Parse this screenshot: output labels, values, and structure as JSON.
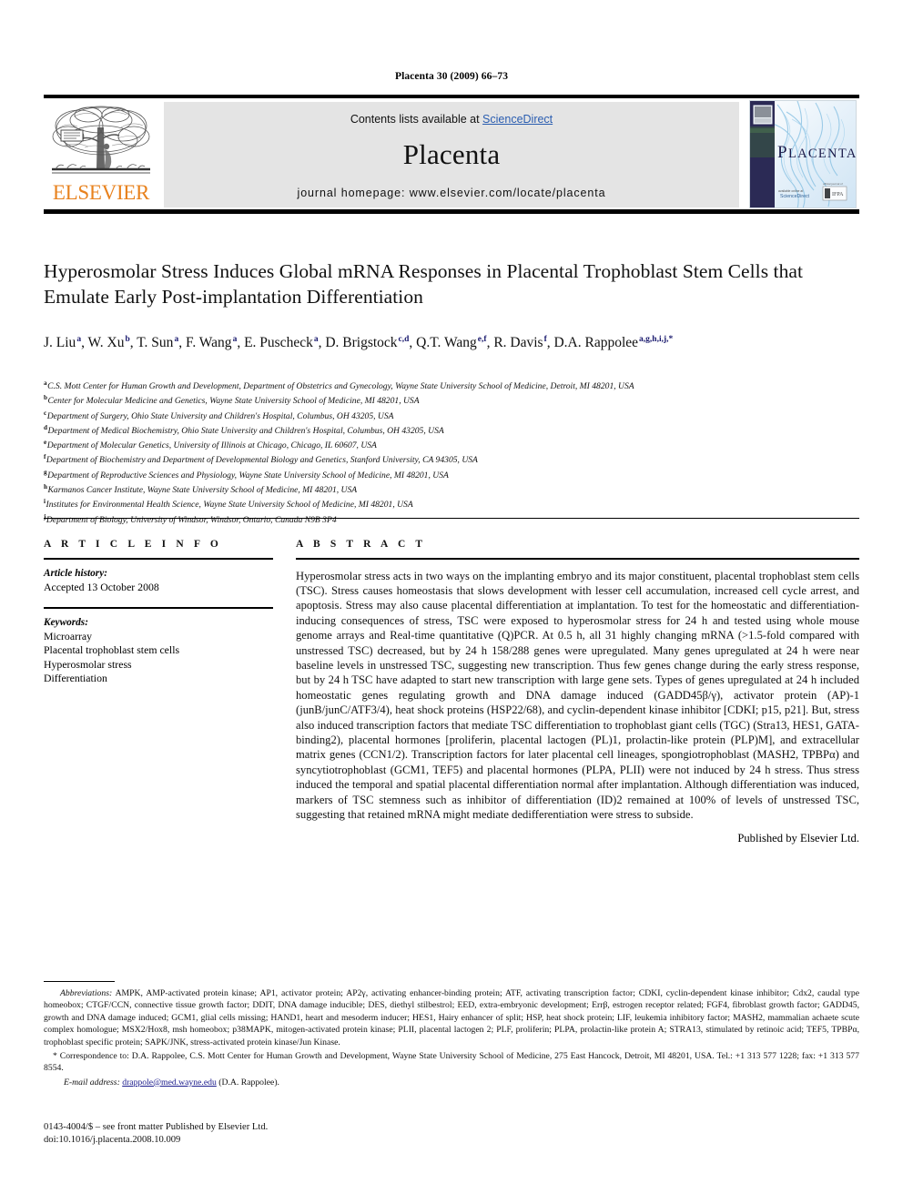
{
  "running_head": "Placenta 30 (2009) 66–73",
  "masthead": {
    "elsevier_wordmark": "ELSEVIER",
    "contents_prefix": "Contents lists available at ",
    "contents_link": "ScienceDirect",
    "journal_title": "Placenta",
    "homepage_line": "journal homepage: www.elsevier.com/locate/placenta",
    "cover_title": "PLACENTA",
    "accent_orange": "#e8821e",
    "link_blue": "#2a5db0",
    "panel_gray": "#e4e4e4"
  },
  "article": {
    "title": "Hyperosmolar Stress Induces Global mRNA Responses in Placental Trophoblast Stem Cells that Emulate Early Post-implantation Differentiation",
    "authors": [
      {
        "name": "J. Liu",
        "sup": "a"
      },
      {
        "name": "W. Xu",
        "sup": "b"
      },
      {
        "name": "T. Sun",
        "sup": "a"
      },
      {
        "name": "F. Wang",
        "sup": "a"
      },
      {
        "name": "E. Puscheck",
        "sup": "a"
      },
      {
        "name": "D. Brigstock",
        "sup": "c,d"
      },
      {
        "name": "Q.T. Wang",
        "sup": "e,f"
      },
      {
        "name": "R. Davis",
        "sup": "f"
      },
      {
        "name": "D.A. Rappolee",
        "sup": "a,g,h,i,j,*"
      }
    ],
    "affiliations": [
      {
        "marker": "a",
        "text": "C.S. Mott Center for Human Growth and Development, Department of Obstetrics and Gynecology, Wayne State University School of Medicine, Detroit, MI 48201, USA"
      },
      {
        "marker": "b",
        "text": "Center for Molecular Medicine and Genetics, Wayne State University School of Medicine, MI 48201, USA"
      },
      {
        "marker": "c",
        "text": "Department of Surgery, Ohio State University and Children's Hospital, Columbus, OH 43205, USA"
      },
      {
        "marker": "d",
        "text": "Department of Medical Biochemistry, Ohio State University and Children's Hospital, Columbus, OH 43205, USA"
      },
      {
        "marker": "e",
        "text": "Department of Molecular Genetics, University of Illinois at Chicago, Chicago, IL 60607, USA"
      },
      {
        "marker": "f",
        "text": "Department of Biochemistry and Department of Developmental Biology and Genetics, Stanford University, CA 94305, USA"
      },
      {
        "marker": "g",
        "text": "Department of Reproductive Sciences and Physiology, Wayne State University School of Medicine, MI 48201, USA"
      },
      {
        "marker": "h",
        "text": "Karmanos Cancer Institute, Wayne State University School of Medicine, MI 48201, USA"
      },
      {
        "marker": "i",
        "text": "Institutes for Environmental Health Science, Wayne State University School of Medicine, MI 48201, USA"
      },
      {
        "marker": "j",
        "text": "Department of Biology, University of Windsor, Windsor, Ontario, Canada N9B 3P4"
      }
    ]
  },
  "article_info": {
    "heading": "A R T I C L E   I N F O",
    "history_label": "Article history:",
    "history_value": "Accepted 13 October 2008",
    "keywords_label": "Keywords:",
    "keywords": [
      "Microarray",
      "Placental trophoblast stem cells",
      "Hyperosmolar stress",
      "Differentiation"
    ]
  },
  "abstract": {
    "heading": "A B S T R A C T",
    "text": "Hyperosmolar stress acts in two ways on the implanting embryo and its major constituent, placental trophoblast stem cells (TSC). Stress causes homeostasis that slows development with lesser cell accumulation, increased cell cycle arrest, and apoptosis. Stress may also cause placental differentiation at implantation. To test for the homeostatic and differentiation-inducing consequences of stress, TSC were exposed to hyperosmolar stress for 24 h and tested using whole mouse genome arrays and Real-time quantitative (Q)PCR. At 0.5 h, all 31 highly changing mRNA (>1.5-fold compared with unstressed TSC) decreased, but by 24 h 158/288 genes were upregulated. Many genes upregulated at 24 h were near baseline levels in unstressed TSC, suggesting new transcription. Thus few genes change during the early stress response, but by 24 h TSC have adapted to start new transcription with large gene sets. Types of genes upregulated at 24 h included homeostatic genes regulating growth and DNA damage induced (GADD45β/γ), activator protein (AP)-1 (junB/junC/ATF3/4), heat shock proteins (HSP22/68), and cyclin-dependent kinase inhibitor [CDKI; p15, p21]. But, stress also induced transcription factors that mediate TSC differentiation to trophoblast giant cells (TGC) (Stra13, HES1, GATA-binding2), placental hormones [proliferin, placental lactogen (PL)1, prolactin-like protein (PLP)M], and extracellular matrix genes (CCN1/2). Transcription factors for later placental cell lineages, spongiotrophoblast (MASH2, TPBPα) and syncytiotrophoblast (GCM1, TEF5) and placental hormones (PLPA, PLII) were not induced by 24 h stress. Thus stress induced the temporal and spatial placental differentiation normal after implantation. Although differentiation was induced, markers of TSC stemness such as inhibitor of differentiation (ID)2 remained at 100% of levels of unstressed TSC, suggesting that retained mRNA might mediate dedifferentiation were stress to subside.",
    "published_by": "Published by Elsevier Ltd."
  },
  "footnotes": {
    "abbreviations_label": "Abbreviations:",
    "abbreviations_text": "AMPK, AMP-activated protein kinase; AP1, activator protein; AP2γ, activating enhancer-binding protein; ATF, activating transcription factor; CDKI, cyclin-dependent kinase inhibitor; Cdx2, caudal type homeobox; CTGF/CCN, connective tissue growth factor; DDIT, DNA damage inducible; DES, diethyl stilbestrol; EED, extra-embryonic development; Errβ, estrogen receptor related; FGF4, fibroblast growth factor; GADD45, growth and DNA damage induced; GCM1, glial cells missing; HAND1, heart and mesoderm inducer; HES1, Hairy enhancer of split; HSP, heat shock protein; LIF, leukemia inhibitory factor; MASH2, mammalian achaete scute complex homologue; MSX2/Hox8, msh homeobox; p38MAPK, mitogen-activated protein kinase; PLII, placental lactogen 2; PLF, proliferin; PLPA, prolactin-like protein A; STRA13, stimulated by retinoic acid; TEF5, TPBPα, trophoblast specific protein; SAPK/JNK, stress-activated protein kinase/Jun Kinase.",
    "correspondence_marker": "*",
    "correspondence_text": "Correspondence to: D.A. Rappolee, C.S. Mott Center for Human Growth and Development, Wayne State University School of Medicine, 275 East Hancock, Detroit, MI 48201, USA. Tel.: +1 313 577 1228; fax: +1 313 577 8554.",
    "email_label": "E-mail address:",
    "email_address": "drappole@med.wayne.edu",
    "email_suffix": "(D.A. Rappolee)."
  },
  "imprint": {
    "line1": "0143-4004/$ – see front matter Published by Elsevier Ltd.",
    "line2": "doi:10.1016/j.placenta.2008.10.009"
  }
}
